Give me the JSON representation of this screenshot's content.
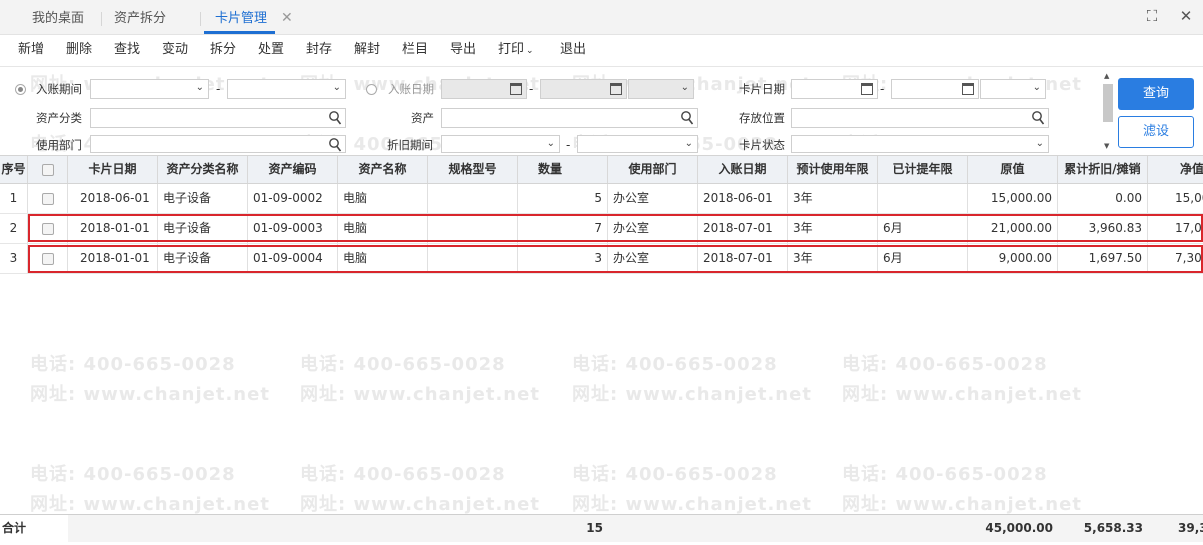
{
  "tabs": [
    "我的桌面",
    "资产拆分",
    "卡片管理"
  ],
  "toolbar": [
    "新增",
    "删除",
    "查找",
    "变动",
    "拆分",
    "处置",
    "封存",
    "解封",
    "栏目",
    "导出",
    "打印",
    "退出"
  ],
  "filters": {
    "posting_period": "入账期间",
    "posting_date": "入账日期",
    "card_date": "卡片日期",
    "asset_category": "资产分类",
    "asset": "资产",
    "storage_location": "存放位置",
    "department": "使用部门",
    "depreciation_period": "折旧期间",
    "card_status": "卡片状态",
    "dash": "-"
  },
  "buttons": {
    "query": "查询",
    "filter": "滤设"
  },
  "columns": [
    "序号",
    "",
    "卡片日期",
    "资产分类名称",
    "资产编码",
    "资产名称",
    "规格型号",
    "数量",
    "使用部门",
    "入账日期",
    "预计使用年限",
    "已计提年限",
    "原值",
    "累计折旧/摊销",
    "净值"
  ],
  "rows": [
    [
      "1",
      "",
      "2018-06-01",
      "电子设备",
      "01-09-0002",
      "电脑",
      "",
      "5",
      "办公室",
      "2018-06-01",
      "3年",
      "",
      "15,000.00",
      "0.00",
      "15,00"
    ],
    [
      "2",
      "",
      "2018-01-01",
      "电子设备",
      "01-09-0003",
      "电脑",
      "",
      "7",
      "办公室",
      "2018-07-01",
      "3年",
      "6月",
      "21,000.00",
      "3,960.83",
      "17,03"
    ],
    [
      "3",
      "",
      "2018-01-01",
      "电子设备",
      "01-09-0004",
      "电脑",
      "",
      "3",
      "办公室",
      "2018-07-01",
      "3年",
      "6月",
      "9,000.00",
      "1,697.50",
      "7,30"
    ]
  ],
  "footer": {
    "label": "合计",
    "qty": "15",
    "original": "45,000.00",
    "dep": "5,658.33",
    "net": "39,34"
  },
  "watermark": {
    "phone": "电话: 400-665-0028",
    "site": "网址: www.chanjet.net"
  },
  "colors": {
    "accent": "#1e6fd2",
    "highlight": "#d9262c"
  }
}
